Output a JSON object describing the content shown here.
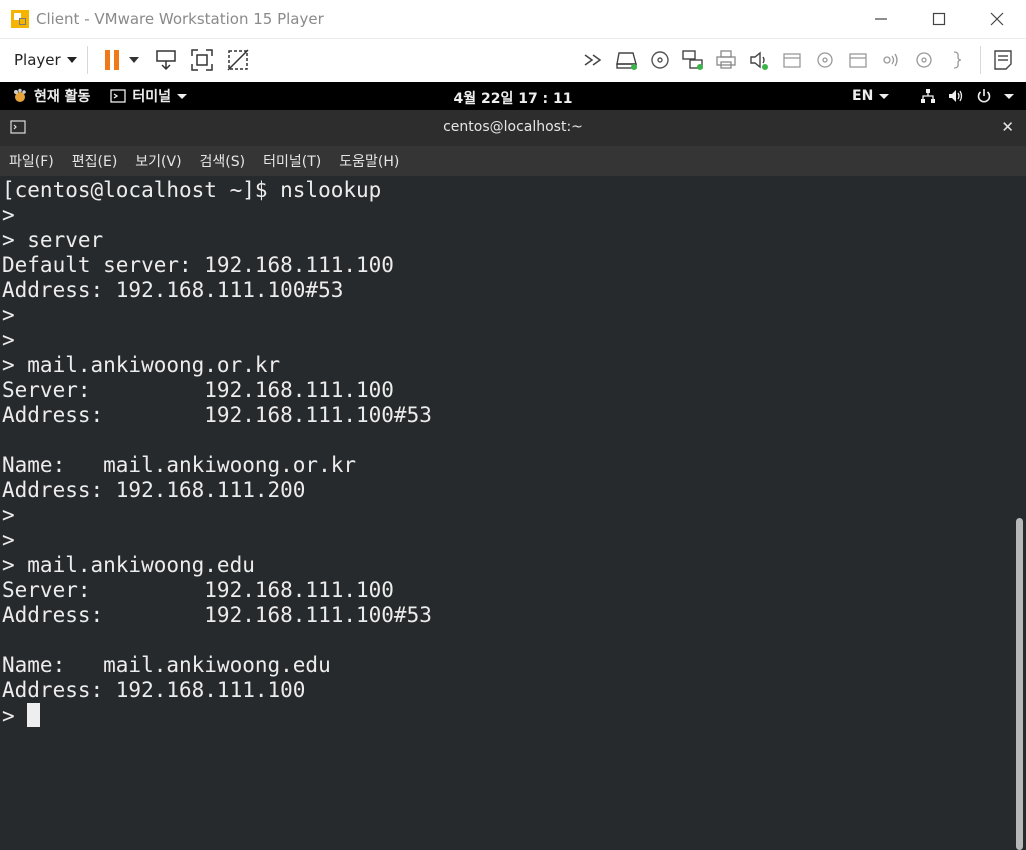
{
  "window": {
    "title": "Client - VMware Workstation 15 Player"
  },
  "toolbar": {
    "player_label": "Player"
  },
  "gnome": {
    "activities": "현재 활동",
    "app_menu": "터미널",
    "clock": "4월 22일  17 : 11",
    "lang": "EN"
  },
  "terminal": {
    "title": "centos@localhost:~",
    "menu": [
      "파일(F)",
      "편집(E)",
      "보기(V)",
      "검색(S)",
      "터미널(T)",
      "도움말(H)"
    ],
    "lines": [
      "[centos@localhost ~]$ nslookup",
      ">",
      "> server",
      "Default server: 192.168.111.100",
      "Address: 192.168.111.100#53",
      ">",
      ">",
      "> mail.ankiwoong.or.kr",
      "Server:         192.168.111.100",
      "Address:        192.168.111.100#53",
      "",
      "Name:   mail.ankiwoong.or.kr",
      "Address: 192.168.111.200",
      ">",
      ">",
      "> mail.ankiwoong.edu",
      "Server:         192.168.111.100",
      "Address:        192.168.111.100#53",
      "",
      "Name:   mail.ankiwoong.edu",
      "Address: 192.168.111.100"
    ],
    "prompt": "> "
  },
  "icons": {
    "app": "vmware-icon",
    "minimize": "minimize-icon",
    "maximize": "maximize-icon",
    "close": "close-icon",
    "pause": "pause-icon",
    "send_cad": "send-ctrl-alt-del-icon",
    "fullscreen": "fullscreen-icon",
    "unity": "unity-icon"
  }
}
